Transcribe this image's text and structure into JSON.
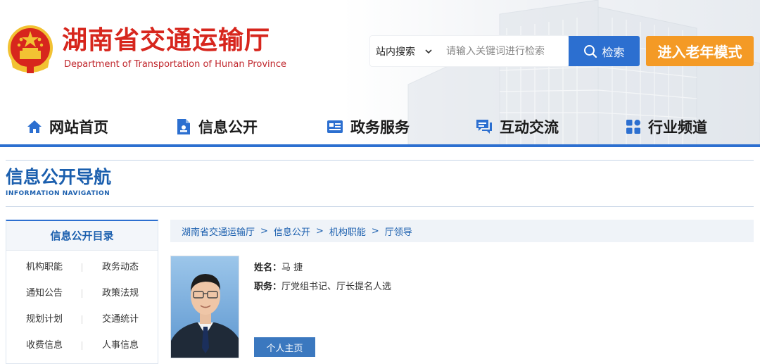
{
  "header": {
    "title_cn": "湖南省交通运输厅",
    "title_en": "Department of Transportation of Hunan Province",
    "logo_icon": "national-emblem-icon"
  },
  "search": {
    "scope_label": "站内搜索",
    "placeholder": "请输入关键词进行检索",
    "value": "",
    "button_label": "检索"
  },
  "elder_mode_label": "进入老年模式",
  "nav": {
    "items": [
      {
        "label": "网站首页",
        "icon": "home-icon"
      },
      {
        "label": "信息公开",
        "icon": "document-icon"
      },
      {
        "label": "政务服务",
        "icon": "card-icon"
      },
      {
        "label": "互动交流",
        "icon": "chat-icon"
      },
      {
        "label": "行业频道",
        "icon": "grid-icon"
      }
    ]
  },
  "section": {
    "title": "信息公开导航",
    "subtitle": "INFORMATION NAVIGATION"
  },
  "sidebar": {
    "heading": "信息公开目录",
    "rows": [
      [
        "机构职能",
        "政务动态"
      ],
      [
        "通知公告",
        "政策法规"
      ],
      [
        "规划计划",
        "交通统计"
      ],
      [
        "收费信息",
        "人事信息"
      ]
    ]
  },
  "breadcrumb": [
    "湖南省交通运输厅",
    "信息公开",
    "机构职能",
    "厅领导"
  ],
  "breadcrumb_sep": ">",
  "profile": {
    "name_label": "姓名：",
    "name": "马 捷",
    "role_label": "职务：",
    "role": "厅党组书记、厅长提名人选",
    "home_button": "个人主页"
  },
  "colors": {
    "brand_red": "#d7261d",
    "brand_blue": "#2c6fd0",
    "elder_orange": "#f49a25",
    "link_blue": "#1b5fae"
  }
}
